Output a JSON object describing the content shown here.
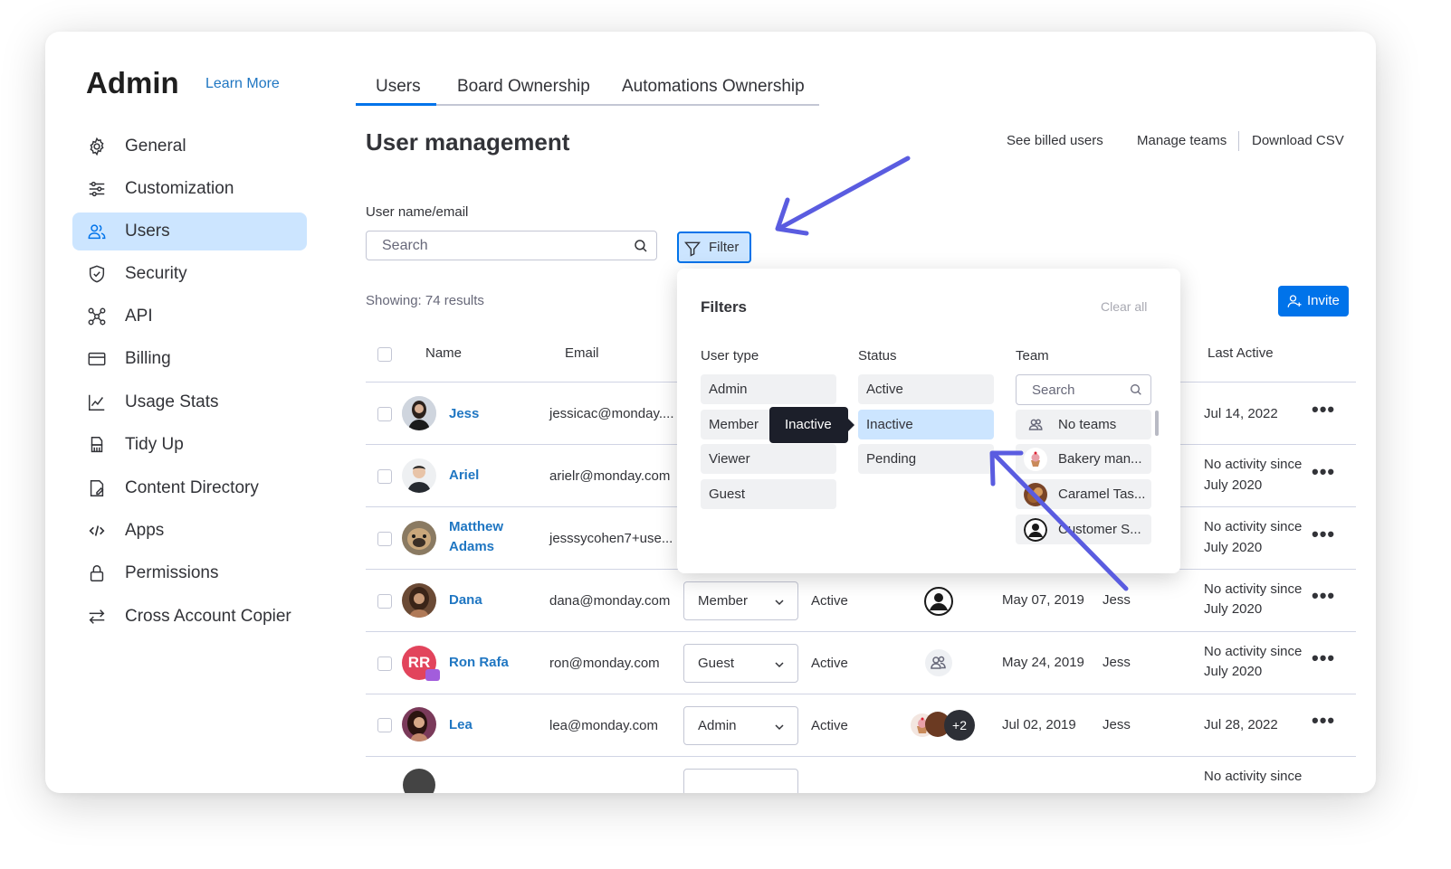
{
  "header": {
    "title": "Admin",
    "learn_more": "Learn More"
  },
  "sidebar": {
    "items": [
      {
        "label": "General",
        "icon": "gear-icon"
      },
      {
        "label": "Customization",
        "icon": "sliders-icon"
      },
      {
        "label": "Users",
        "icon": "users-icon",
        "active": true
      },
      {
        "label": "Security",
        "icon": "shield-icon"
      },
      {
        "label": "API",
        "icon": "api-icon"
      },
      {
        "label": "Billing",
        "icon": "credit-card-icon"
      },
      {
        "label": "Usage Stats",
        "icon": "chart-icon"
      },
      {
        "label": "Tidy Up",
        "icon": "broom-icon"
      },
      {
        "label": "Content Directory",
        "icon": "document-icon"
      },
      {
        "label": "Apps",
        "icon": "code-icon"
      },
      {
        "label": "Permissions",
        "icon": "lock-icon"
      },
      {
        "label": "Cross Account Copier",
        "icon": "transfer-icon"
      }
    ]
  },
  "tabs": [
    {
      "label": "Users",
      "active": true
    },
    {
      "label": "Board Ownership"
    },
    {
      "label": "Automations Ownership"
    }
  ],
  "main": {
    "title": "User management",
    "links": {
      "billed": "See billed users",
      "teams": "Manage teams",
      "csv": "Download CSV"
    },
    "search_label": "User name/email",
    "search_placeholder": "Search",
    "filter_button": "Filter",
    "showing": "Showing: 74 results",
    "invite_button": "Invite"
  },
  "table": {
    "headers": {
      "name": "Name",
      "email": "Email",
      "last_active": "Last Active"
    },
    "rows": [
      {
        "name": "Jess",
        "email": "jessicac@monday....",
        "last_active": "Jul 14, 2022"
      },
      {
        "name": "Ariel",
        "email": "arielr@monday.com",
        "last_active_1": "No activity since",
        "last_active_2": "July 2020"
      },
      {
        "name_1": "Matthew",
        "name_2": "Adams",
        "email": "jesssycohen7+use...",
        "last_active_1": "No activity since",
        "last_active_2": "July 2020"
      },
      {
        "name": "Dana",
        "email": "dana@monday.com",
        "role": "Member",
        "status": "Active",
        "joined": "May 07, 2019",
        "invited_by": "Jess",
        "last_active_1": "No activity since",
        "last_active_2": "July 2020"
      },
      {
        "name": "Ron Rafa",
        "initials": "RR",
        "email": "ron@monday.com",
        "role": "Guest",
        "status": "Active",
        "joined": "May 24, 2019",
        "invited_by": "Jess",
        "last_active_1": "No activity since",
        "last_active_2": "July 2020"
      },
      {
        "name": "Lea",
        "email": "lea@monday.com",
        "role": "Admin",
        "status": "Active",
        "teams_more": "+2",
        "joined": "Jul 02, 2019",
        "invited_by": "Jess",
        "last_active": "Jul 28, 2022"
      },
      {
        "last_active_1": "No activity since"
      }
    ]
  },
  "filters": {
    "title": "Filters",
    "clear_all": "Clear all",
    "user_type": {
      "label": "User type",
      "options": [
        "Admin",
        "Member",
        "Viewer",
        "Guest"
      ]
    },
    "status": {
      "label": "Status",
      "options": [
        "Active",
        "Inactive",
        "Pending"
      ],
      "selected": "Inactive"
    },
    "team": {
      "label": "Team",
      "search_placeholder": "Search",
      "options": [
        "No teams",
        "Bakery man...",
        "Caramel Tas...",
        "Customer S..."
      ]
    },
    "tooltip": "Inactive"
  },
  "colors": {
    "accent": "#0073ea",
    "link": "#1f76c2",
    "selected": "#cce5ff",
    "annotation": "#5a5ce0"
  }
}
